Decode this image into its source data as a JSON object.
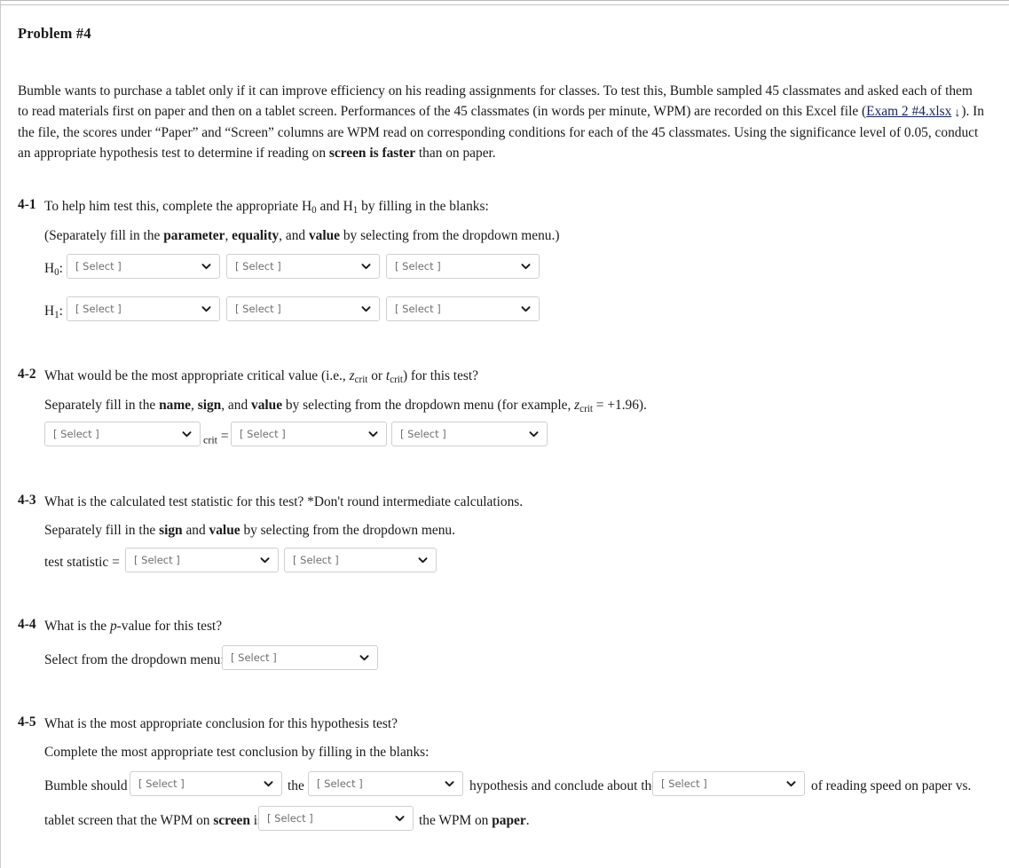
{
  "page": {
    "title": "Problem #4"
  },
  "intro": {
    "part1": "Bumble wants to purchase a tablet only if it can improve efficiency on his reading assignments for classes. To test this, Bumble sampled 45 classmates and asked each of them to read materials first on paper and then on a tablet screen. Performances of the 45 classmates (in words per minute, WPM) are recorded on this Excel file (",
    "link_text": "Exam 2 #4.xlsx",
    "download_icon": "↓",
    "part2": "). In the file, the scores under “Paper” and “Screen” columns are WPM read on corresponding conditions for each of the 45 classmates. Using the significance level of 0.05, conduct an appropriate hypothesis test to determine if reading on ",
    "bold_phrase": "screen is faster",
    "part3": " than on paper."
  },
  "select_placeholder": "[ Select ]",
  "q41": {
    "number": "4-1",
    "prompt_a": "To help him test this, complete the appropriate H",
    "prompt_sub0": "0",
    "prompt_b": " and H",
    "prompt_sub1": "1",
    "prompt_c": " by filling in the blanks:",
    "sub_a": "(Separately fill in the ",
    "sub_bold1": "parameter",
    "sub_b": ", ",
    "sub_bold2": "equality",
    "sub_c": ", and ",
    "sub_bold3": "value",
    "sub_d": " by selecting from the dropdown menu.)",
    "h0_label": "H",
    "h0_sub": "0",
    "h0_colon": ":",
    "h1_label": "H",
    "h1_sub": "1",
    "h1_colon": ":",
    "h0_selects": [
      "[ Select ]",
      "[ Select ]",
      "[ Select ]"
    ],
    "h1_selects": [
      "[ Select ]",
      "[ Select ]",
      "[ Select ]"
    ]
  },
  "q42": {
    "number": "4-2",
    "prompt_a": "What would be the most appropriate critical value (i.e., ",
    "prompt_z": "z",
    "prompt_zsub": "crit",
    "prompt_or": " or ",
    "prompt_t": "t",
    "prompt_tsub": "crit",
    "prompt_b": ") for this test?",
    "sub_a": "Separately fill in the ",
    "sub_bold1": "name",
    "sub_b": ", ",
    "sub_bold2": "sign",
    "sub_c": ", and ",
    "sub_bold3": "value",
    "sub_d": " by selecting from the dropdown menu (for example, ",
    "sub_z": "z",
    "sub_zsub": "crit",
    "sub_e": " = +1.96).",
    "crit_label_sub": "crit",
    "crit_label_eq": " =",
    "selects": [
      "[ Select ]",
      "[ Select ]",
      "[ Select ]"
    ]
  },
  "q43": {
    "number": "4-3",
    "prompt": "What is the calculated test statistic for this test? *Don't round intermediate calculations.",
    "sub_a": "Separately fill in the ",
    "sub_bold1": "sign",
    "sub_b": " and ",
    "sub_bold2": "value",
    "sub_c": " by selecting from the dropdown menu.",
    "row_label": "test statistic =",
    "selects": [
      "[ Select ]",
      "[ Select ]"
    ]
  },
  "q44": {
    "number": "4-4",
    "prompt_a": "What is the ",
    "prompt_p": "p",
    "prompt_b": "-value for this test?",
    "row_label": "Select from the dropdown menu:",
    "selects": [
      "[ Select ]"
    ]
  },
  "q45": {
    "number": "4-5",
    "prompt": "What is the most appropriate conclusion for this hypothesis test?",
    "sub": "Complete the most appropriate test conclusion by filling in the blanks:",
    "line1_a": "Bumble should",
    "line1_b": "the",
    "line1_c": "hypothesis and conclude about the",
    "line1_d": "of reading speed on paper vs.",
    "line2_a": "tablet screen that the WPM on ",
    "line2_bold1": "screen",
    "line2_b": " is",
    "line2_c": "the WPM on ",
    "line2_bold2": "paper",
    "line2_d": ".",
    "selects": [
      "[ Select ]",
      "[ Select ]",
      "[ Select ]",
      "[ Select ]"
    ]
  },
  "colors": {
    "link": "#16225c",
    "select_border": "#cfcfcf",
    "select_text": "#6e6e6e",
    "page_text": "#1a1a1a"
  }
}
